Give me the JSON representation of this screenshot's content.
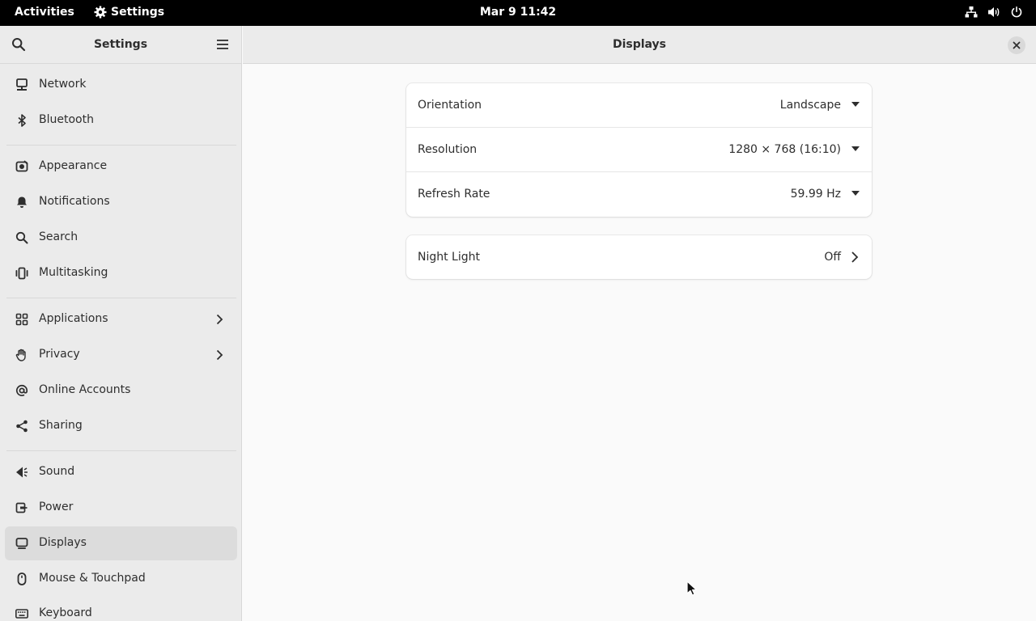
{
  "topbar": {
    "activities": "Activities",
    "app_name": "Settings",
    "clock": "Mar 9  11:42"
  },
  "sidebar": {
    "title": "Settings",
    "items": [
      {
        "label": "Network",
        "icon": "network-icon"
      },
      {
        "label": "Bluetooth",
        "icon": "bluetooth-icon"
      },
      {
        "label": "Appearance",
        "icon": "appearance-icon"
      },
      {
        "label": "Notifications",
        "icon": "bell-icon"
      },
      {
        "label": "Search",
        "icon": "search-icon"
      },
      {
        "label": "Multitasking",
        "icon": "multitasking-icon"
      },
      {
        "label": "Applications",
        "icon": "applications-icon"
      },
      {
        "label": "Privacy",
        "icon": "hand-icon"
      },
      {
        "label": "Online Accounts",
        "icon": "at-icon"
      },
      {
        "label": "Sharing",
        "icon": "share-icon"
      },
      {
        "label": "Sound",
        "icon": "speaker-icon"
      },
      {
        "label": "Power",
        "icon": "power-plug-icon"
      },
      {
        "label": "Displays",
        "icon": "display-icon",
        "selected": true
      },
      {
        "label": "Mouse & Touchpad",
        "icon": "mouse-icon"
      },
      {
        "label": "Keyboard",
        "icon": "keyboard-icon"
      }
    ]
  },
  "main": {
    "title": "Displays",
    "display_settings": [
      {
        "label": "Orientation",
        "value": "Landscape"
      },
      {
        "label": "Resolution",
        "value": "1280 × 768 (16:10)"
      },
      {
        "label": "Refresh Rate",
        "value": "59.99 Hz"
      }
    ],
    "night_light": {
      "label": "Night Light",
      "value": "Off"
    }
  }
}
